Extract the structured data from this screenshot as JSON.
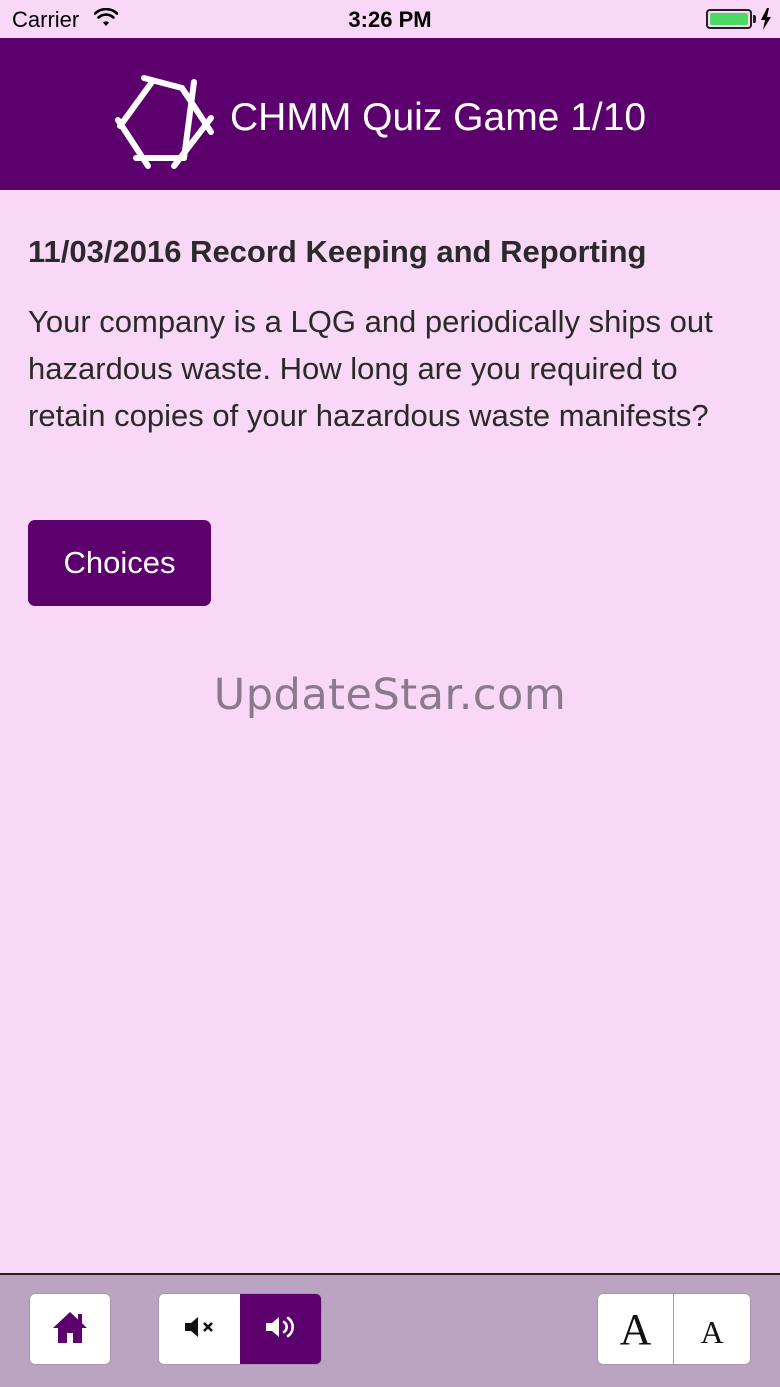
{
  "status_bar": {
    "carrier": "Carrier",
    "time": "3:26 PM",
    "battery_level": 1.0,
    "battery_color": "#4cd964"
  },
  "header": {
    "title": "CHMM Quiz Game 1/10",
    "background_color": "#5c006d",
    "logo_icon": "hexagon-logo-icon"
  },
  "question": {
    "title": "11/03/2016 Record Keeping and Reporting",
    "text": "Your company is a LQG and periodically ships out hazardous waste.  How long are you required to retain copies of your hazardous waste manifests?"
  },
  "choices_button": {
    "label": "Choices"
  },
  "watermark": "UpdateStar.com",
  "toolbar": {
    "home_icon": "home-icon",
    "mute_icon": "speaker-mute-icon",
    "unmute_icon": "speaker-on-icon",
    "sound_selected": "on",
    "font_larger_label": "A",
    "font_smaller_label": "A"
  },
  "colors": {
    "background": "#f8d8f6",
    "accent": "#5c006d",
    "toolbar": "#bba4c1"
  }
}
